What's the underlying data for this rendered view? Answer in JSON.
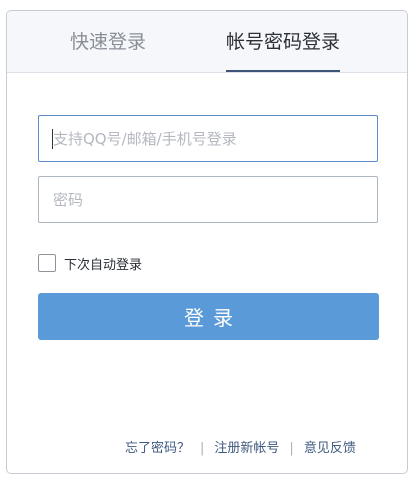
{
  "tabs": {
    "quick_login": "快速登录",
    "password_login": "帐号密码登录",
    "active": "password_login"
  },
  "form": {
    "account_placeholder": "支持QQ号/邮箱/手机号登录",
    "password_placeholder": "密码",
    "remember_label": "下次自动登录",
    "remember_checked": false,
    "login_button": "登录"
  },
  "footer": {
    "forgot_password": "忘了密码？",
    "register": "注册新帐号",
    "feedback": "意见反馈"
  },
  "colors": {
    "accent": "#5b9ad9",
    "link": "#3f5a7f",
    "active_tab_underline": "#3e5577"
  }
}
